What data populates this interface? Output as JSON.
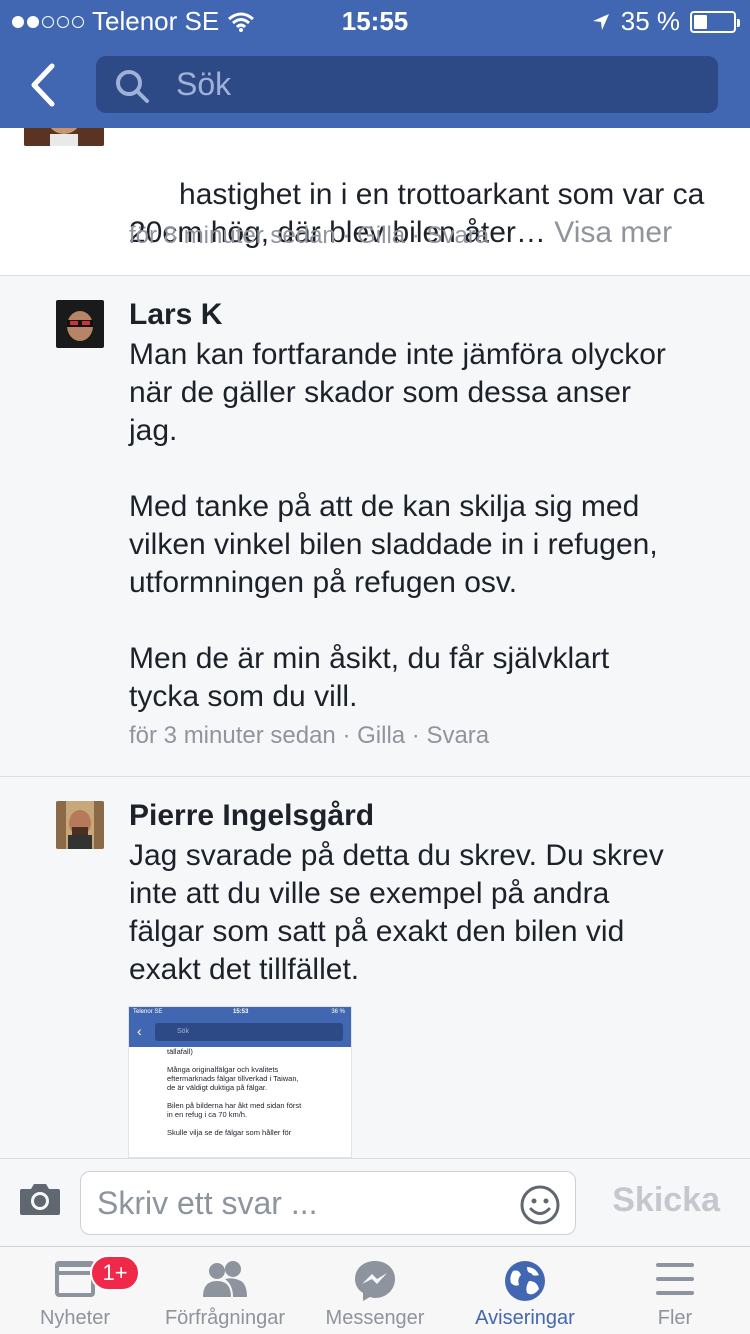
{
  "status_bar": {
    "carrier": "Telenor SE",
    "time": "15:55",
    "battery": "35 %",
    "battery_level": 0.35
  },
  "search": {
    "placeholder": "Sök"
  },
  "comments": [
    {
      "body": "hastighet in i en trottoarkant som var ca\n20cm hög, där blev bilen åter…",
      "visa_mer": "Visa mer",
      "meta": "för 8 minuter sedan · Gilla · Svara"
    },
    {
      "name": "Lars K",
      "body": "Man kan fortfarande inte jämföra olyckor\nnär de gäller skador som dessa anser\njag.\n\nMed tanke på att de kan skilja sig med\nvilken vinkel bilen sladdade in i refugen,\nutformningen på refugen osv.\n\nMen de är min åsikt, du får självklart\ntycka som du vill.",
      "meta": "för 3 minuter sedan · Gilla · Svara"
    },
    {
      "name": "Pierre Ingelsgård",
      "body": "Jag svarade på detta du skrev. Du skrev\ninte att du ville se exempel på andra\nfälgar som satt på exakt den bilen vid\nexakt det tillfället.",
      "attachment": {
        "carrier": "Telenor SE",
        "time": "15:53",
        "battery": "36 %",
        "search": "Sök",
        "text": "tällafall)\n\nMånga originalfälgar och kvalitets\neftermarknads fälgar tillverkad i Taiwan,\nde är väldigt duktiga på fälgar.\n\nBilen på bilderna har åkt med sidan först\nin en refug i ca 70 km/h.\n\nSkulle vilja se de fälgar som håller för"
      }
    }
  ],
  "composer": {
    "placeholder": "Skriv ett svar ...",
    "send_label": "Skicka"
  },
  "tabs": [
    {
      "label": "Nyheter",
      "badge": "1+",
      "icon": "news-feed-icon"
    },
    {
      "label": "Förfrågningar",
      "icon": "friend-requests-icon"
    },
    {
      "label": "Messenger",
      "icon": "messenger-icon"
    },
    {
      "label": "Aviseringar",
      "icon": "globe-icon",
      "active": true
    },
    {
      "label": "Fler",
      "icon": "menu-icon"
    }
  ],
  "colors": {
    "brand": "#4267b2",
    "meta_text": "#90949c",
    "badge": "#f02849"
  }
}
